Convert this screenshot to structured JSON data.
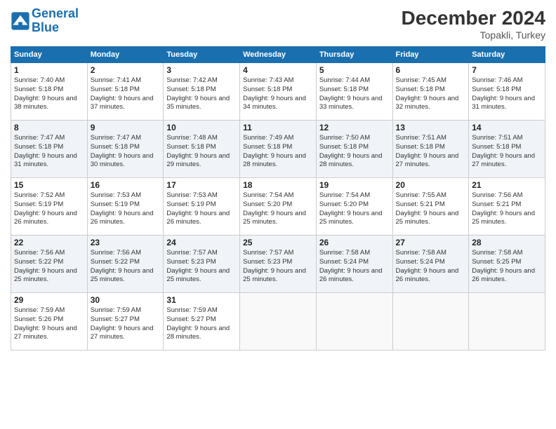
{
  "header": {
    "logo_line1": "General",
    "logo_line2": "Blue",
    "month_title": "December 2024",
    "location": "Topakli, Turkey"
  },
  "days_of_week": [
    "Sunday",
    "Monday",
    "Tuesday",
    "Wednesday",
    "Thursday",
    "Friday",
    "Saturday"
  ],
  "weeks": [
    [
      {
        "num": "1",
        "sunrise": "Sunrise: 7:40 AM",
        "sunset": "Sunset: 5:18 PM",
        "daylight": "Daylight: 9 hours and 38 minutes."
      },
      {
        "num": "2",
        "sunrise": "Sunrise: 7:41 AM",
        "sunset": "Sunset: 5:18 PM",
        "daylight": "Daylight: 9 hours and 37 minutes."
      },
      {
        "num": "3",
        "sunrise": "Sunrise: 7:42 AM",
        "sunset": "Sunset: 5:18 PM",
        "daylight": "Daylight: 9 hours and 35 minutes."
      },
      {
        "num": "4",
        "sunrise": "Sunrise: 7:43 AM",
        "sunset": "Sunset: 5:18 PM",
        "daylight": "Daylight: 9 hours and 34 minutes."
      },
      {
        "num": "5",
        "sunrise": "Sunrise: 7:44 AM",
        "sunset": "Sunset: 5:18 PM",
        "daylight": "Daylight: 9 hours and 33 minutes."
      },
      {
        "num": "6",
        "sunrise": "Sunrise: 7:45 AM",
        "sunset": "Sunset: 5:18 PM",
        "daylight": "Daylight: 9 hours and 32 minutes."
      },
      {
        "num": "7",
        "sunrise": "Sunrise: 7:46 AM",
        "sunset": "Sunset: 5:18 PM",
        "daylight": "Daylight: 9 hours and 31 minutes."
      }
    ],
    [
      {
        "num": "8",
        "sunrise": "Sunrise: 7:47 AM",
        "sunset": "Sunset: 5:18 PM",
        "daylight": "Daylight: 9 hours and 31 minutes."
      },
      {
        "num": "9",
        "sunrise": "Sunrise: 7:47 AM",
        "sunset": "Sunset: 5:18 PM",
        "daylight": "Daylight: 9 hours and 30 minutes."
      },
      {
        "num": "10",
        "sunrise": "Sunrise: 7:48 AM",
        "sunset": "Sunset: 5:18 PM",
        "daylight": "Daylight: 9 hours and 29 minutes."
      },
      {
        "num": "11",
        "sunrise": "Sunrise: 7:49 AM",
        "sunset": "Sunset: 5:18 PM",
        "daylight": "Daylight: 9 hours and 28 minutes."
      },
      {
        "num": "12",
        "sunrise": "Sunrise: 7:50 AM",
        "sunset": "Sunset: 5:18 PM",
        "daylight": "Daylight: 9 hours and 28 minutes."
      },
      {
        "num": "13",
        "sunrise": "Sunrise: 7:51 AM",
        "sunset": "Sunset: 5:18 PM",
        "daylight": "Daylight: 9 hours and 27 minutes."
      },
      {
        "num": "14",
        "sunrise": "Sunrise: 7:51 AM",
        "sunset": "Sunset: 5:18 PM",
        "daylight": "Daylight: 9 hours and 27 minutes."
      }
    ],
    [
      {
        "num": "15",
        "sunrise": "Sunrise: 7:52 AM",
        "sunset": "Sunset: 5:19 PM",
        "daylight": "Daylight: 9 hours and 26 minutes."
      },
      {
        "num": "16",
        "sunrise": "Sunrise: 7:53 AM",
        "sunset": "Sunset: 5:19 PM",
        "daylight": "Daylight: 9 hours and 26 minutes."
      },
      {
        "num": "17",
        "sunrise": "Sunrise: 7:53 AM",
        "sunset": "Sunset: 5:19 PM",
        "daylight": "Daylight: 9 hours and 26 minutes."
      },
      {
        "num": "18",
        "sunrise": "Sunrise: 7:54 AM",
        "sunset": "Sunset: 5:20 PM",
        "daylight": "Daylight: 9 hours and 25 minutes."
      },
      {
        "num": "19",
        "sunrise": "Sunrise: 7:54 AM",
        "sunset": "Sunset: 5:20 PM",
        "daylight": "Daylight: 9 hours and 25 minutes."
      },
      {
        "num": "20",
        "sunrise": "Sunrise: 7:55 AM",
        "sunset": "Sunset: 5:21 PM",
        "daylight": "Daylight: 9 hours and 25 minutes."
      },
      {
        "num": "21",
        "sunrise": "Sunrise: 7:56 AM",
        "sunset": "Sunset: 5:21 PM",
        "daylight": "Daylight: 9 hours and 25 minutes."
      }
    ],
    [
      {
        "num": "22",
        "sunrise": "Sunrise: 7:56 AM",
        "sunset": "Sunset: 5:22 PM",
        "daylight": "Daylight: 9 hours and 25 minutes."
      },
      {
        "num": "23",
        "sunrise": "Sunrise: 7:56 AM",
        "sunset": "Sunset: 5:22 PM",
        "daylight": "Daylight: 9 hours and 25 minutes."
      },
      {
        "num": "24",
        "sunrise": "Sunrise: 7:57 AM",
        "sunset": "Sunset: 5:23 PM",
        "daylight": "Daylight: 9 hours and 25 minutes."
      },
      {
        "num": "25",
        "sunrise": "Sunrise: 7:57 AM",
        "sunset": "Sunset: 5:23 PM",
        "daylight": "Daylight: 9 hours and 25 minutes."
      },
      {
        "num": "26",
        "sunrise": "Sunrise: 7:58 AM",
        "sunset": "Sunset: 5:24 PM",
        "daylight": "Daylight: 9 hours and 26 minutes."
      },
      {
        "num": "27",
        "sunrise": "Sunrise: 7:58 AM",
        "sunset": "Sunset: 5:24 PM",
        "daylight": "Daylight: 9 hours and 26 minutes."
      },
      {
        "num": "28",
        "sunrise": "Sunrise: 7:58 AM",
        "sunset": "Sunset: 5:25 PM",
        "daylight": "Daylight: 9 hours and 26 minutes."
      }
    ],
    [
      {
        "num": "29",
        "sunrise": "Sunrise: 7:59 AM",
        "sunset": "Sunset: 5:26 PM",
        "daylight": "Daylight: 9 hours and 27 minutes."
      },
      {
        "num": "30",
        "sunrise": "Sunrise: 7:59 AM",
        "sunset": "Sunset: 5:27 PM",
        "daylight": "Daylight: 9 hours and 27 minutes."
      },
      {
        "num": "31",
        "sunrise": "Sunrise: 7:59 AM",
        "sunset": "Sunset: 5:27 PM",
        "daylight": "Daylight: 9 hours and 28 minutes."
      },
      null,
      null,
      null,
      null
    ]
  ]
}
